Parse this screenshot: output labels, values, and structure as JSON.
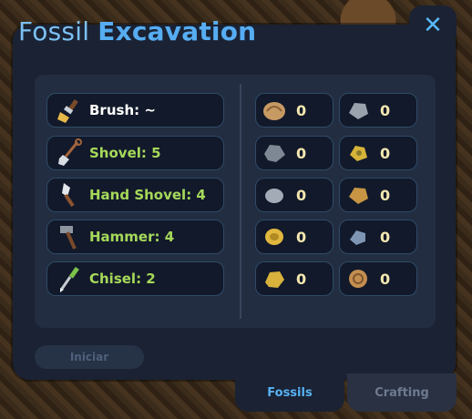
{
  "window": {
    "title_light": "Fossil",
    "title_bold": "Excavation",
    "close_label": "✕"
  },
  "tools": [
    {
      "label": "Brush: ~",
      "icon": "brush-icon",
      "color": "#ffffff"
    },
    {
      "label": "Shovel: 5",
      "icon": "shovel-icon",
      "color": "#a6d95a"
    },
    {
      "label": "Hand Shovel: 4",
      "icon": "hand-shovel-icon",
      "color": "#a6d95a"
    },
    {
      "label": "Hammer: 4",
      "icon": "hammer-icon",
      "color": "#a6d95a"
    },
    {
      "label": "Chisel: 2",
      "icon": "chisel-icon",
      "color": "#a6d95a"
    }
  ],
  "fossils": [
    {
      "icon": "fossil-shell-icon",
      "count": "0"
    },
    {
      "icon": "fossil-grey-rock-icon",
      "count": "0"
    },
    {
      "icon": "fossil-grey-stone-icon",
      "count": "0"
    },
    {
      "icon": "fossil-gold-ore-icon",
      "count": "0"
    },
    {
      "icon": "fossil-grey-pebble-icon",
      "count": "0"
    },
    {
      "icon": "fossil-amber-rock-icon",
      "count": "0"
    },
    {
      "icon": "fossil-gold-coin-icon",
      "count": "0"
    },
    {
      "icon": "fossil-blue-stone-icon",
      "count": "0"
    },
    {
      "icon": "fossil-gold-nugget-icon",
      "count": "0"
    },
    {
      "icon": "fossil-ammonite-icon",
      "count": "0"
    }
  ],
  "start_button": "Iniciar",
  "tabs": {
    "fossils": "Fossils",
    "crafting": "Crafting"
  }
}
